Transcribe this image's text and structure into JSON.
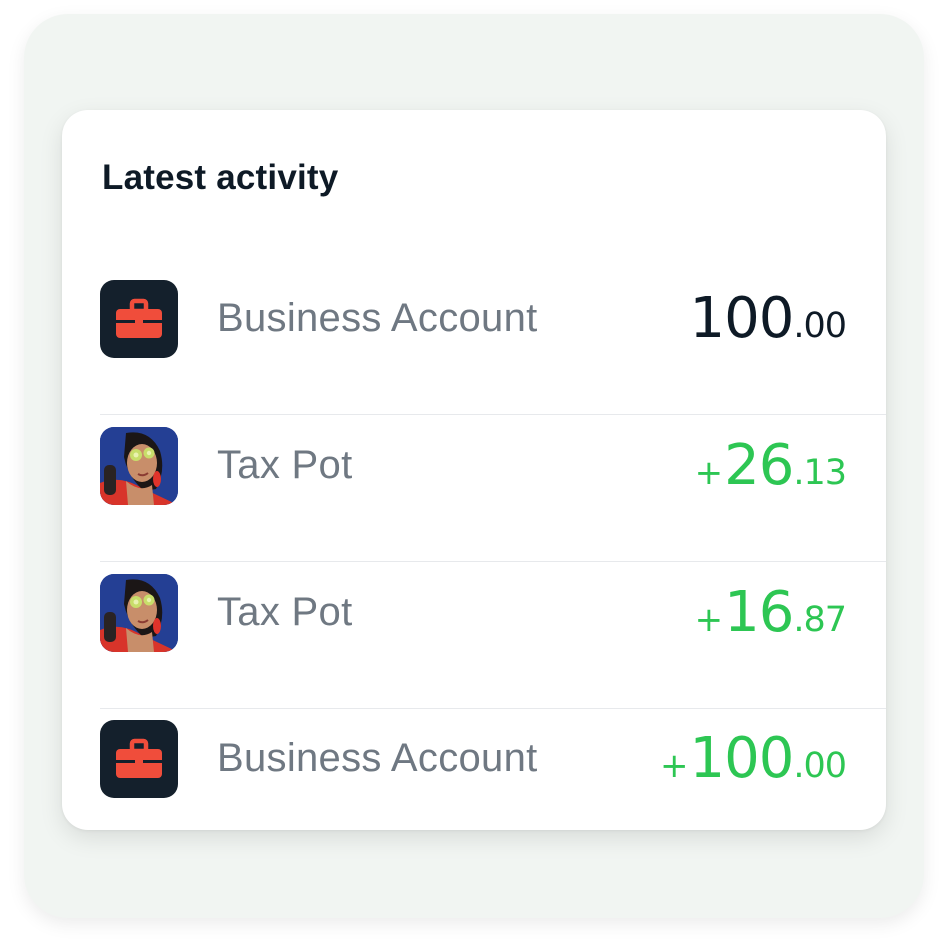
{
  "colors": {
    "positive": "#2dc653",
    "text_primary": "#0e1a26",
    "text_secondary": "#6f7882",
    "brand_dark": "#14202c",
    "brand_red": "#f04d3b"
  },
  "activity": {
    "title": "Latest activity",
    "items": [
      {
        "icon": "briefcase-icon",
        "label": "Business Account",
        "sign": "",
        "major": "100",
        "minor": ".00",
        "direction": "neutral"
      },
      {
        "icon": "avatar",
        "label": "Tax Pot",
        "sign": "+",
        "major": "26",
        "minor": ".13",
        "direction": "incoming"
      },
      {
        "icon": "avatar",
        "label": "Tax Pot",
        "sign": "+",
        "major": "16",
        "minor": ".87",
        "direction": "incoming"
      },
      {
        "icon": "briefcase-icon",
        "label": "Business Account",
        "sign": "+",
        "major": "100",
        "minor": ".00",
        "direction": "incoming"
      }
    ]
  }
}
